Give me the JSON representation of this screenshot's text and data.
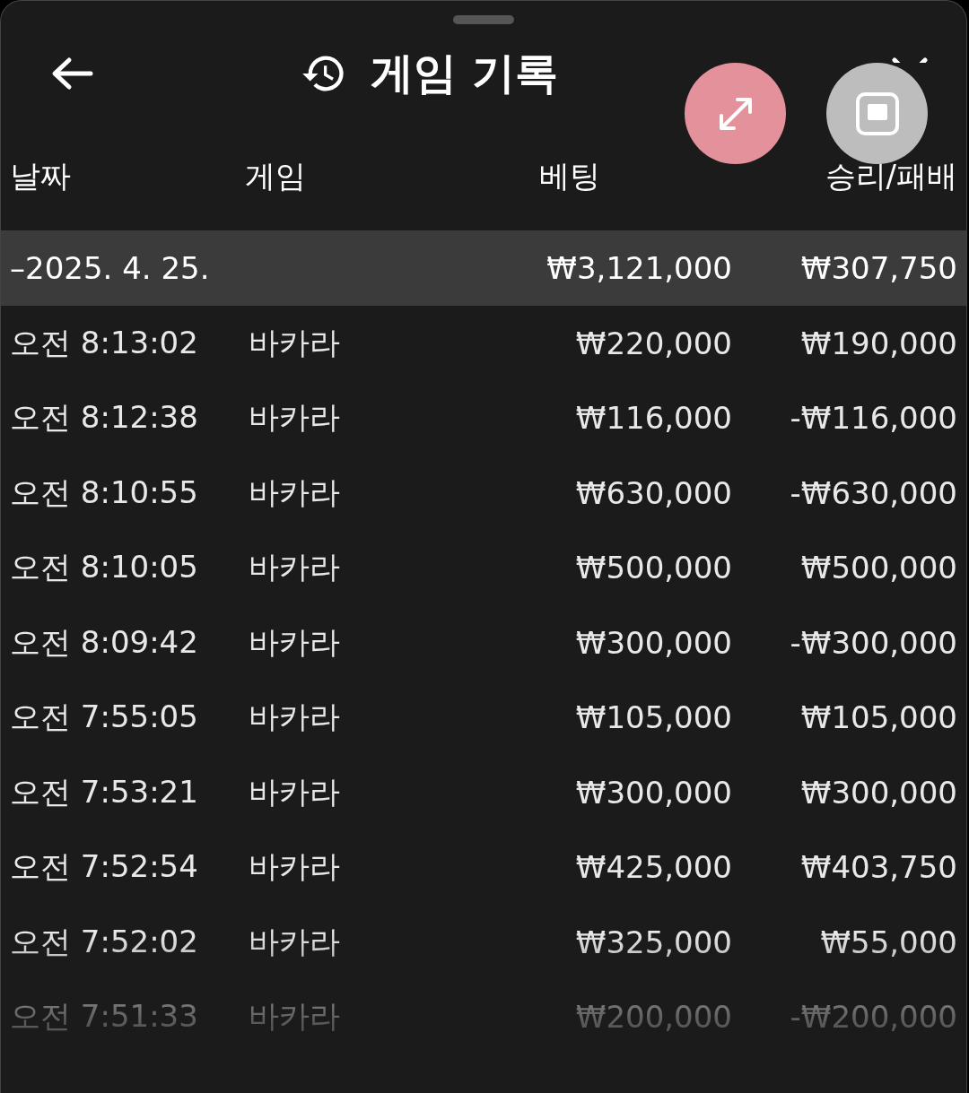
{
  "header": {
    "title": "게임 기록"
  },
  "columns": [
    "날짜",
    "게임",
    "베팅",
    "승리/패배"
  ],
  "group": {
    "toggle": "–",
    "date": "2025. 4. 25.",
    "bet": "₩3,121,000",
    "result": "₩307,750"
  },
  "rows": [
    {
      "time": "오전 8:13:02",
      "game": "바카라",
      "bet": "₩220,000",
      "result": "₩190,000"
    },
    {
      "time": "오전 8:12:38",
      "game": "바카라",
      "bet": "₩116,000",
      "result": "-₩116,000"
    },
    {
      "time": "오전 8:10:55",
      "game": "바카라",
      "bet": "₩630,000",
      "result": "-₩630,000"
    },
    {
      "time": "오전 8:10:05",
      "game": "바카라",
      "bet": "₩500,000",
      "result": "₩500,000"
    },
    {
      "time": "오전 8:09:42",
      "game": "바카라",
      "bet": "₩300,000",
      "result": "-₩300,000"
    },
    {
      "time": "오전 7:55:05",
      "game": "바카라",
      "bet": "₩105,000",
      "result": "₩105,000"
    },
    {
      "time": "오전 7:53:21",
      "game": "바카라",
      "bet": "₩300,000",
      "result": "₩300,000"
    },
    {
      "time": "오전 7:52:54",
      "game": "바카라",
      "bet": "₩425,000",
      "result": "₩403,750"
    },
    {
      "time": "오전 7:52:02",
      "game": "바카라",
      "bet": "₩325,000",
      "result": "₩55,000"
    },
    {
      "time": "오전 7:51:33",
      "game": "바카라",
      "bet": "₩200,000",
      "result": "-₩200,000"
    }
  ]
}
